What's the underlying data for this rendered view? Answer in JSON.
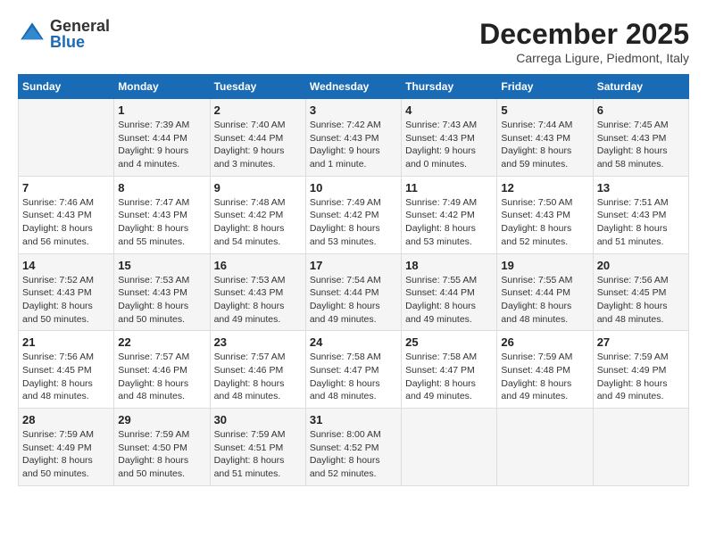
{
  "header": {
    "logo_line1": "General",
    "logo_line2": "Blue",
    "month_title": "December 2025",
    "location": "Carrega Ligure, Piedmont, Italy"
  },
  "days_of_week": [
    "Sunday",
    "Monday",
    "Tuesday",
    "Wednesday",
    "Thursday",
    "Friday",
    "Saturday"
  ],
  "weeks": [
    [
      {
        "day": "",
        "info": ""
      },
      {
        "day": "1",
        "info": "Sunrise: 7:39 AM\nSunset: 4:44 PM\nDaylight: 9 hours\nand 4 minutes."
      },
      {
        "day": "2",
        "info": "Sunrise: 7:40 AM\nSunset: 4:44 PM\nDaylight: 9 hours\nand 3 minutes."
      },
      {
        "day": "3",
        "info": "Sunrise: 7:42 AM\nSunset: 4:43 PM\nDaylight: 9 hours\nand 1 minute."
      },
      {
        "day": "4",
        "info": "Sunrise: 7:43 AM\nSunset: 4:43 PM\nDaylight: 9 hours\nand 0 minutes."
      },
      {
        "day": "5",
        "info": "Sunrise: 7:44 AM\nSunset: 4:43 PM\nDaylight: 8 hours\nand 59 minutes."
      },
      {
        "day": "6",
        "info": "Sunrise: 7:45 AM\nSunset: 4:43 PM\nDaylight: 8 hours\nand 58 minutes."
      }
    ],
    [
      {
        "day": "7",
        "info": "Sunrise: 7:46 AM\nSunset: 4:43 PM\nDaylight: 8 hours\nand 56 minutes."
      },
      {
        "day": "8",
        "info": "Sunrise: 7:47 AM\nSunset: 4:43 PM\nDaylight: 8 hours\nand 55 minutes."
      },
      {
        "day": "9",
        "info": "Sunrise: 7:48 AM\nSunset: 4:42 PM\nDaylight: 8 hours\nand 54 minutes."
      },
      {
        "day": "10",
        "info": "Sunrise: 7:49 AM\nSunset: 4:42 PM\nDaylight: 8 hours\nand 53 minutes."
      },
      {
        "day": "11",
        "info": "Sunrise: 7:49 AM\nSunset: 4:42 PM\nDaylight: 8 hours\nand 53 minutes."
      },
      {
        "day": "12",
        "info": "Sunrise: 7:50 AM\nSunset: 4:43 PM\nDaylight: 8 hours\nand 52 minutes."
      },
      {
        "day": "13",
        "info": "Sunrise: 7:51 AM\nSunset: 4:43 PM\nDaylight: 8 hours\nand 51 minutes."
      }
    ],
    [
      {
        "day": "14",
        "info": "Sunrise: 7:52 AM\nSunset: 4:43 PM\nDaylight: 8 hours\nand 50 minutes."
      },
      {
        "day": "15",
        "info": "Sunrise: 7:53 AM\nSunset: 4:43 PM\nDaylight: 8 hours\nand 50 minutes."
      },
      {
        "day": "16",
        "info": "Sunrise: 7:53 AM\nSunset: 4:43 PM\nDaylight: 8 hours\nand 49 minutes."
      },
      {
        "day": "17",
        "info": "Sunrise: 7:54 AM\nSunset: 4:44 PM\nDaylight: 8 hours\nand 49 minutes."
      },
      {
        "day": "18",
        "info": "Sunrise: 7:55 AM\nSunset: 4:44 PM\nDaylight: 8 hours\nand 49 minutes."
      },
      {
        "day": "19",
        "info": "Sunrise: 7:55 AM\nSunset: 4:44 PM\nDaylight: 8 hours\nand 48 minutes."
      },
      {
        "day": "20",
        "info": "Sunrise: 7:56 AM\nSunset: 4:45 PM\nDaylight: 8 hours\nand 48 minutes."
      }
    ],
    [
      {
        "day": "21",
        "info": "Sunrise: 7:56 AM\nSunset: 4:45 PM\nDaylight: 8 hours\nand 48 minutes."
      },
      {
        "day": "22",
        "info": "Sunrise: 7:57 AM\nSunset: 4:46 PM\nDaylight: 8 hours\nand 48 minutes."
      },
      {
        "day": "23",
        "info": "Sunrise: 7:57 AM\nSunset: 4:46 PM\nDaylight: 8 hours\nand 48 minutes."
      },
      {
        "day": "24",
        "info": "Sunrise: 7:58 AM\nSunset: 4:47 PM\nDaylight: 8 hours\nand 48 minutes."
      },
      {
        "day": "25",
        "info": "Sunrise: 7:58 AM\nSunset: 4:47 PM\nDaylight: 8 hours\nand 49 minutes."
      },
      {
        "day": "26",
        "info": "Sunrise: 7:59 AM\nSunset: 4:48 PM\nDaylight: 8 hours\nand 49 minutes."
      },
      {
        "day": "27",
        "info": "Sunrise: 7:59 AM\nSunset: 4:49 PM\nDaylight: 8 hours\nand 49 minutes."
      }
    ],
    [
      {
        "day": "28",
        "info": "Sunrise: 7:59 AM\nSunset: 4:49 PM\nDaylight: 8 hours\nand 50 minutes."
      },
      {
        "day": "29",
        "info": "Sunrise: 7:59 AM\nSunset: 4:50 PM\nDaylight: 8 hours\nand 50 minutes."
      },
      {
        "day": "30",
        "info": "Sunrise: 7:59 AM\nSunset: 4:51 PM\nDaylight: 8 hours\nand 51 minutes."
      },
      {
        "day": "31",
        "info": "Sunrise: 8:00 AM\nSunset: 4:52 PM\nDaylight: 8 hours\nand 52 minutes."
      },
      {
        "day": "",
        "info": ""
      },
      {
        "day": "",
        "info": ""
      },
      {
        "day": "",
        "info": ""
      }
    ]
  ]
}
